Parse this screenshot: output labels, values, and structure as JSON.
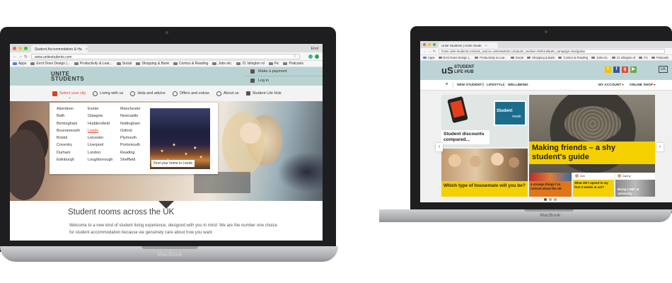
{
  "left_laptop": {
    "brand": "MacBook",
    "browser": {
      "tab_title": "Student Accommodation & Ha",
      "profile": "Errol",
      "url": "www.unitestudents.com",
      "bookmarks": [
        "Apps",
        "Errol Does Design |...",
        "Productivity & Lear...",
        "Social",
        "Shopping & Bank",
        "Comics & Reading",
        "Jobs etc.",
        "21 Islington rd",
        "Fic",
        "Podcasts"
      ]
    },
    "site": {
      "logo_line1": "UNITE",
      "logo_line2": "STUDENTS",
      "header_links": [
        "Make a payment",
        "Log in"
      ],
      "nav": [
        "Select your city",
        "Living with us",
        "Help and advice",
        "Offers and extras",
        "About us",
        "Student Life Hub"
      ],
      "cities_col1": [
        "Aberdeen",
        "Bath",
        "Birmingham",
        "Bournemouth",
        "Bristol",
        "Coventry",
        "Durham",
        "Edinburgh"
      ],
      "cities_col2": [
        "Exeter",
        "Glasgow",
        "Huddersfield",
        "Leeds",
        "Leicester",
        "Liverpool",
        "London",
        "Loughborough"
      ],
      "cities_col3": [
        "Manchester",
        "Newcastle",
        "Nottingham",
        "Oxford",
        "Plymouth",
        "Portsmouth",
        "Reading",
        "Sheffield"
      ],
      "active_city": "Leeds",
      "photo_cta": "Find your home in Leeds",
      "headline": "Student rooms across the UK",
      "intro": "Welcome to a new kind of student living experience, designed with you in mind. We are the number one choice for student accommodation because we genuinely care about how you want"
    }
  },
  "right_laptop": {
    "brand": "MacBook",
    "browser": {
      "tab_title": "Unite Students | Unite Stude",
      "url": "home.unite-students.com/utm_source=unitestudents.com&utm_medium=Referral&utm_campaign=Navigation",
      "bookmarks": [
        "Apps",
        "Errol Does Design |...",
        "Productivity & Lear...",
        "Social",
        "Shopping & Bank",
        "Comics & Reading",
        "Jobs etc.",
        "21 Islington rd",
        "Fic",
        "Podcasts"
      ]
    },
    "site": {
      "logo_mark": "uS",
      "logo_line1": "STUDENT",
      "logo_line2": "LIFE HUB",
      "country": "UK",
      "nav_left": [
        "NEW STUDENTS",
        "LIFESTYLE",
        "WELLBEING"
      ],
      "nav_right": [
        "MY ACCOUNT",
        "ONLINE SHOP"
      ],
      "cards": {
        "discounts": "Student discounts compared...",
        "feature_line1": "Making friends – a shy",
        "feature_line2": "student's guide",
        "housemate": "Which type of housemate will you be?",
        "strange": "4 strange things I've noticed about the UK",
        "two_weeks": "What did I spend in my first 2 weeks at uni?",
        "lgbt": "Being LGBT at university",
        "author1": "Ann",
        "author2": "Danny",
        "phone_label": "Student",
        "phone_label2": "made"
      }
    }
  },
  "colors": {
    "accent_red": "#e2401c",
    "header_teal": "#b9d3d3",
    "hub_yellow": "#f4d000"
  }
}
